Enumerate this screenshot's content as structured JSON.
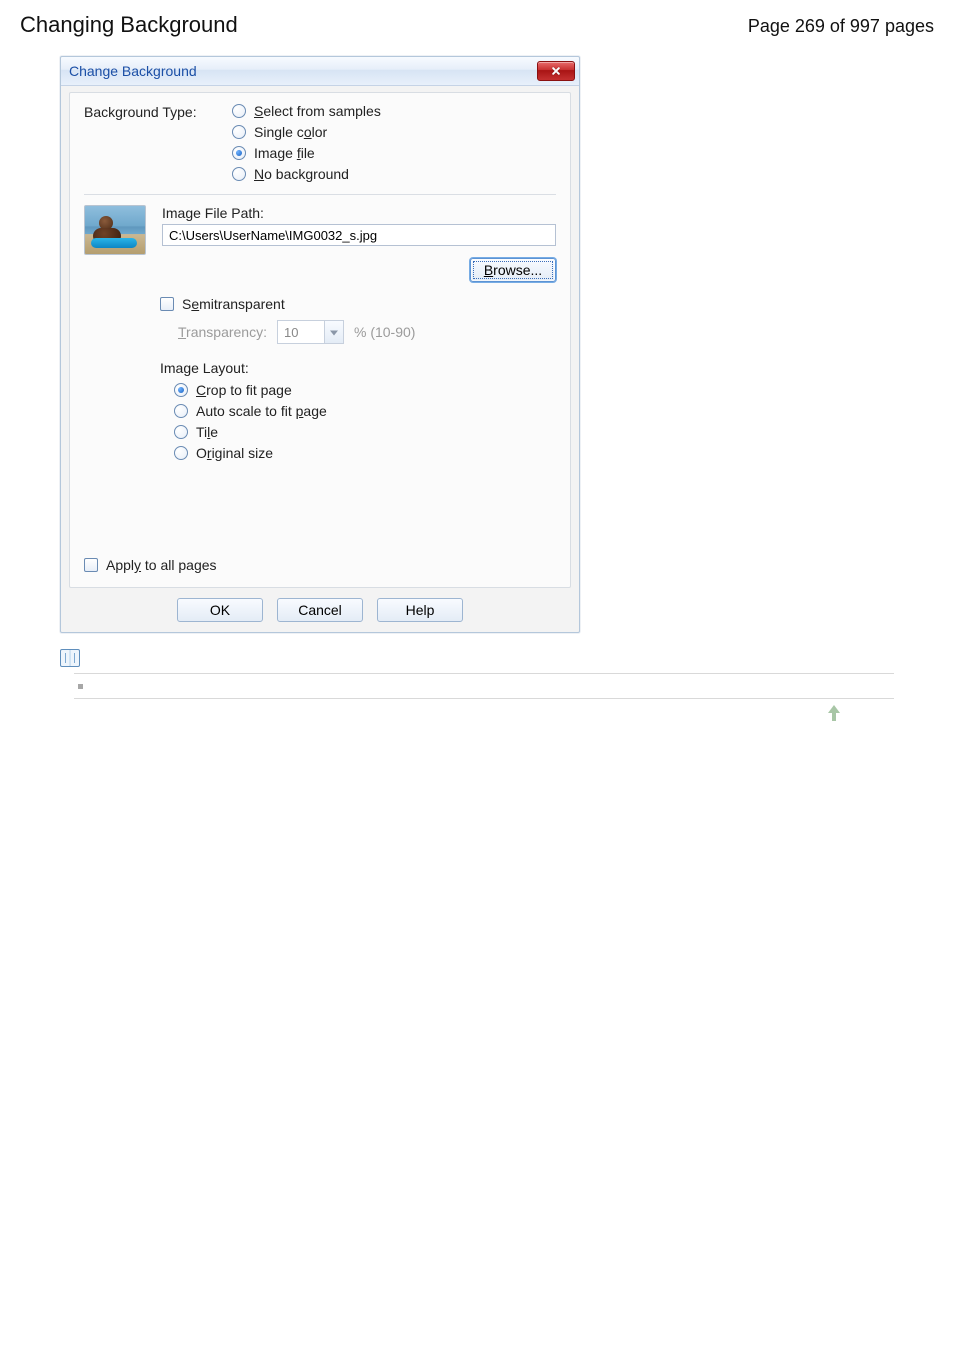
{
  "header": {
    "title": "Changing Background",
    "page_indicator": "Page 269 of 997 pages"
  },
  "dialog": {
    "title": "Change Background",
    "type_label": "Background Type:",
    "types": {
      "select_samples": {
        "pre": "",
        "u": "S",
        "post": "elect from samples"
      },
      "single_color": {
        "pre": "Single c",
        "u": "o",
        "post": "lor"
      },
      "image_file": {
        "pre": "Image ",
        "u": "f",
        "post": "ile"
      },
      "no_background": {
        "pre": "",
        "u": "N",
        "post": "o background"
      }
    },
    "file_path_label": "Image File Path:",
    "file_path_value": "C:\\Users\\UserName\\IMG0032_s.jpg",
    "browse": {
      "u": "B",
      "post": "rowse..."
    },
    "semitransparent": {
      "pre": "S",
      "u": "e",
      "post": "mitransparent"
    },
    "transparency": {
      "u": "T",
      "post": "ransparency:",
      "value": "10",
      "suffix": "% (10-90)"
    },
    "layout_label": "Image Layout:",
    "layouts": {
      "crop": {
        "u": "C",
        "post": "rop to fit page"
      },
      "auto": {
        "pre": "Auto scale to fit ",
        "u": "p",
        "post": "age"
      },
      "tile": {
        "pre": "Ti",
        "u": "l",
        "post": "e"
      },
      "original": {
        "pre": "O",
        "u": "r",
        "post": "iginal size"
      }
    },
    "apply_all": {
      "pre": "Appl",
      "u": "y",
      "post": " to all pages"
    },
    "buttons": {
      "ok": "OK",
      "cancel": "Cancel",
      "help": "Help"
    }
  }
}
